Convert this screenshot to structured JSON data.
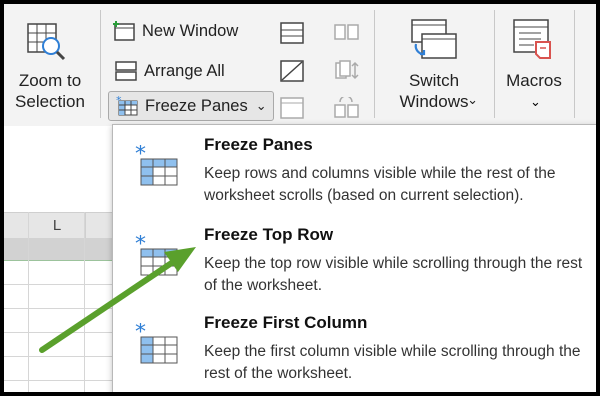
{
  "ribbon": {
    "zoom_to_selection": "Zoom to\nSelection",
    "new_window": "New Window",
    "arrange_all": "Arrange All",
    "freeze_panes": "Freeze Panes",
    "switch_windows": "Switch\nWindows",
    "macros": "Macros"
  },
  "sheet": {
    "column_label": "L"
  },
  "menu": {
    "items": [
      {
        "title": "Freeze Panes",
        "desc": "Keep rows and columns visible while the rest of the worksheet scrolls (based on current selection)."
      },
      {
        "title": "Freeze Top Row",
        "desc": "Keep the top row visible while scrolling through the rest of the worksheet."
      },
      {
        "title": "Freeze First Column",
        "desc": "Keep the first column visible while scrolling through the rest of the worksheet."
      }
    ]
  },
  "colors": {
    "accent_blue": "#2f7fd6",
    "arrow_green": "#5aa02c",
    "menu_bg": "#ffffff",
    "ribbon_bg": "#f3f3f3"
  }
}
